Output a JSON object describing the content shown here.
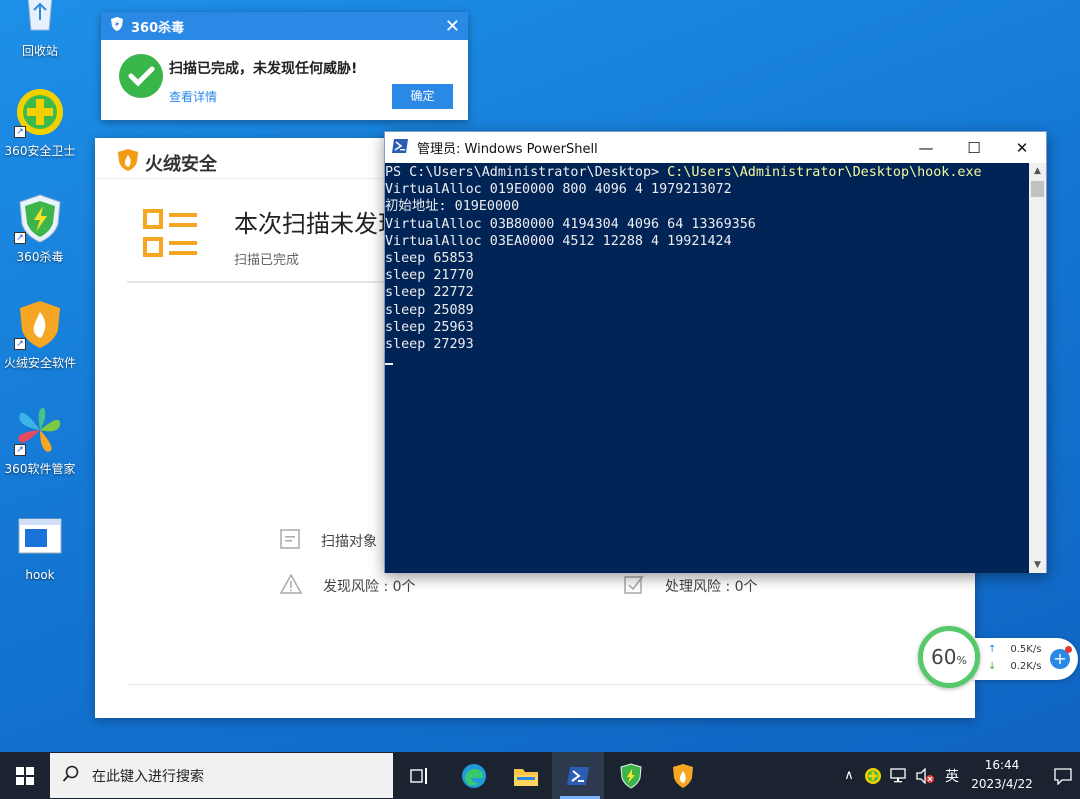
{
  "desktop": {
    "icons": [
      {
        "label": "回收站"
      },
      {
        "label": "360安全卫士"
      },
      {
        "label": "360杀毒"
      },
      {
        "label": "火绒安全软件"
      },
      {
        "label": "360软件管家"
      },
      {
        "label": "hook"
      }
    ]
  },
  "popup360": {
    "title": "360杀毒",
    "close": "✕",
    "message": "扫描已完成，未发现任何威胁!",
    "link": "查看详情",
    "ok_button": "确定"
  },
  "huorong": {
    "brand": "火绒安全",
    "headline": "本次扫描未发现",
    "subline": "扫描已完成",
    "stats": {
      "scan_object": "扫描对象",
      "risk_found": "发现风险 : 0个",
      "risk_handled": "处理风险 : 0个"
    }
  },
  "powershell": {
    "title": "管理员: Windows PowerShell",
    "prompt": "PS C:\\Users\\Administrator\\Desktop> ",
    "command": "C:\\Users\\Administrator\\Desktop\\hook.exe",
    "output": [
      "",
      "VirtualAlloc 019E0000 800 4096 4 1979213072",
      "初始地址: 019E0000",
      "VirtualAlloc 03B80000 4194304 4096 64 13369356",
      "VirtualAlloc 03EA0000 4512 12288 4 19921424",
      "sleep 65853",
      "sleep 21770",
      "sleep 22772",
      "sleep 25089",
      "sleep 25963",
      "sleep 27293"
    ],
    "controls": {
      "minimize": "—",
      "maximize": "☐",
      "close": "✕"
    }
  },
  "float_ball": {
    "percent": "60",
    "unit": "%",
    "up_speed": "0.5K/s",
    "down_speed": "0.2K/s",
    "up_arrow": "↑",
    "down_arrow": "↓",
    "plus": "+"
  },
  "taskbar": {
    "search_placeholder": "在此键入进行搜索",
    "ime": "英",
    "time": "16:44",
    "date": "2023/4/22",
    "tray_chevron": "∧"
  },
  "colors": {
    "desktop": "#1478d4",
    "console_bg": "#012456",
    "accent_360": "#2b89e6",
    "huorong_orange": "#f39c12",
    "ball_green": "#56c96a"
  }
}
